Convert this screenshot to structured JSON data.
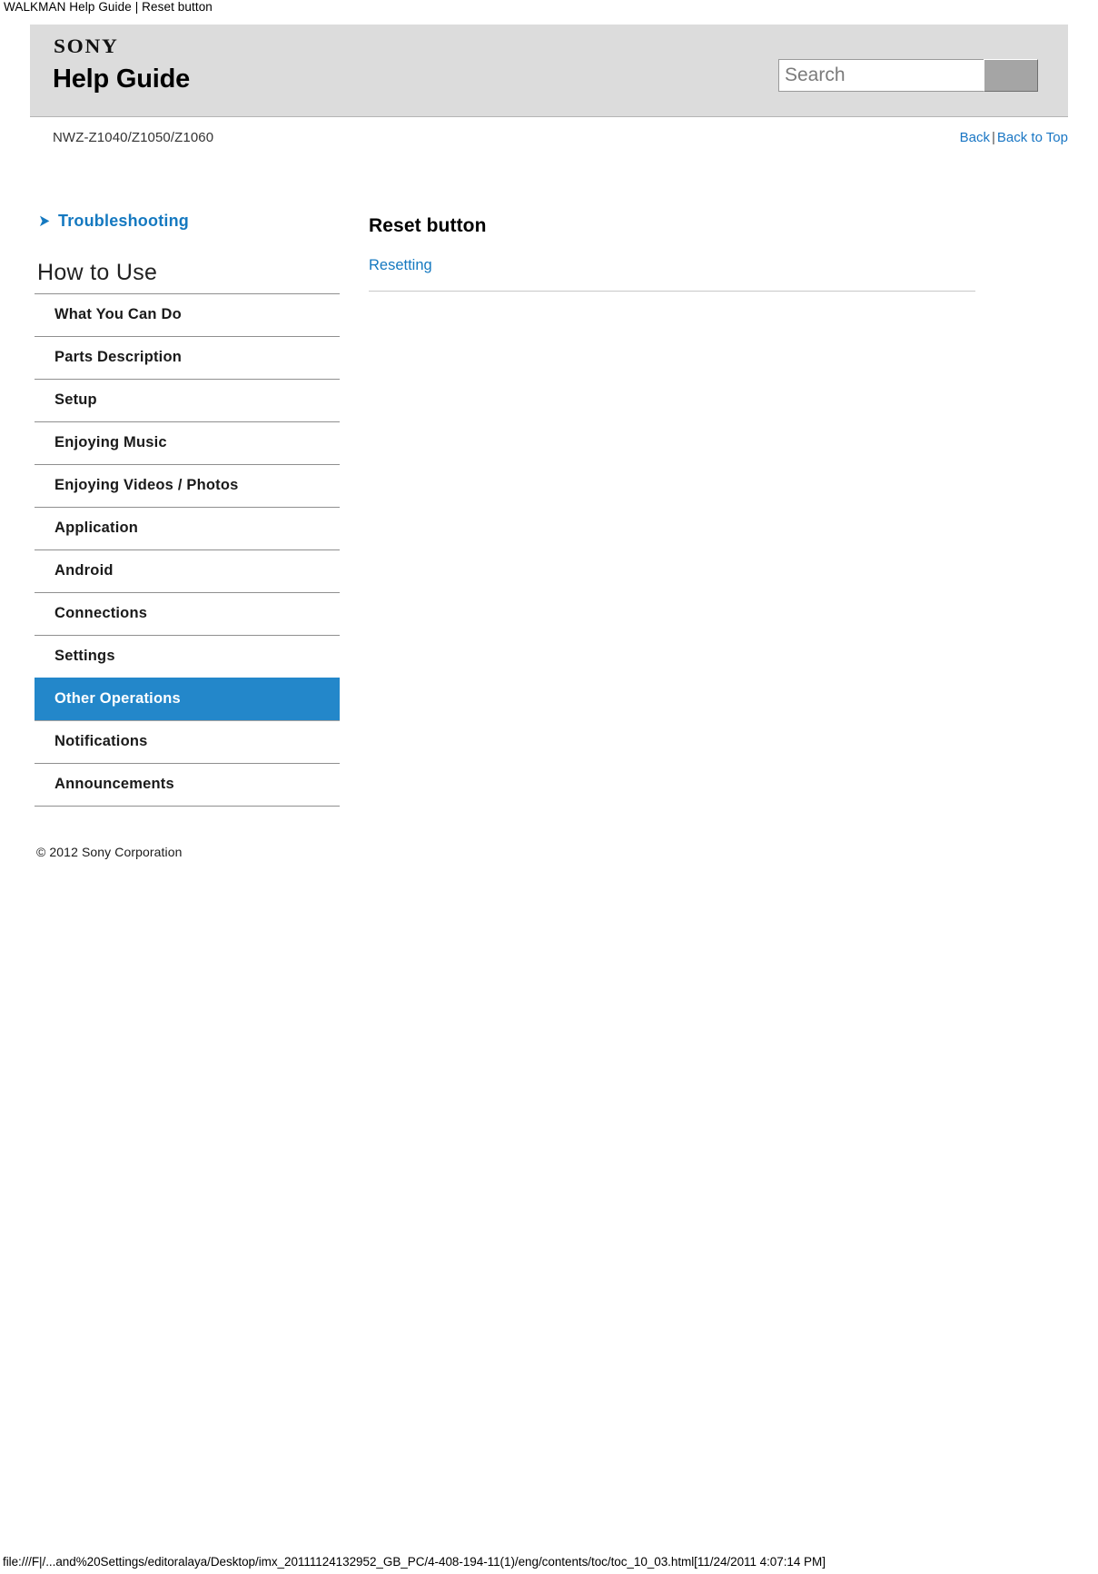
{
  "window": {
    "print_header": "WALKMAN Help Guide | Reset button"
  },
  "header": {
    "brand_logo_text": "SONY",
    "site_title": "Help Guide",
    "search": {
      "placeholder": "Search",
      "value": "",
      "button_label": ""
    }
  },
  "model_bar": {
    "model": "NWZ-Z1040/Z1050/Z1060",
    "back_label": "Back",
    "separator": "|",
    "back_to_top_label": "Back to Top"
  },
  "sidebar": {
    "troubleshooting_label": "Troubleshooting",
    "troubleshooting_icon": "double-chevron-right-icon",
    "section_heading": "How to Use",
    "items": [
      {
        "label": "What You Can Do",
        "selected": false
      },
      {
        "label": "Parts Description",
        "selected": false
      },
      {
        "label": "Setup",
        "selected": false
      },
      {
        "label": "Enjoying Music",
        "selected": false
      },
      {
        "label": "Enjoying Videos / Photos",
        "selected": false
      },
      {
        "label": "Application",
        "selected": false
      },
      {
        "label": "Android",
        "selected": false
      },
      {
        "label": "Connections",
        "selected": false
      },
      {
        "label": "Settings",
        "selected": false
      },
      {
        "label": "Other Operations",
        "selected": true
      },
      {
        "label": "Notifications",
        "selected": false
      },
      {
        "label": "Announcements",
        "selected": false
      }
    ],
    "copyright": "© 2012 Sony Corporation"
  },
  "main": {
    "title": "Reset button",
    "links": [
      {
        "label": "Resetting"
      }
    ]
  },
  "footer": {
    "path": "file:///F|/...and%20Settings/editoralaya/Desktop/imx_20111124132952_GB_PC/4-408-194-11(1)/eng/contents/toc/toc_10_03.html[11/24/2011 4:07:14 PM]"
  },
  "colors": {
    "accent_blue": "#1579c0",
    "selected_row_blue": "#2387ca",
    "masthead_gray": "#dcdcdc",
    "rule_gray": "#8f8f8f"
  }
}
